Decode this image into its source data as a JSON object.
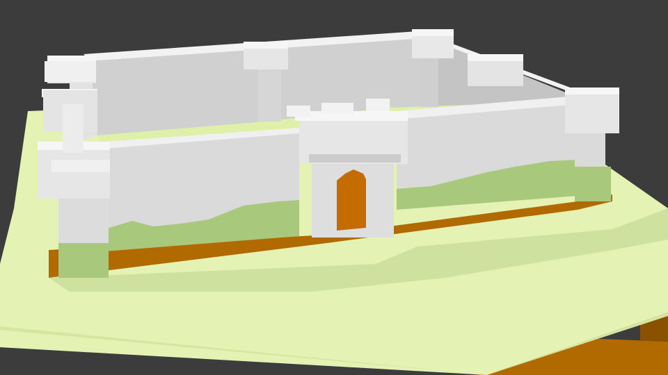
{
  "scene": {
    "subject": "voxel-castle",
    "colors": {
      "background": "#3c3c3c",
      "grass_top": "#e4f3b4",
      "grass_shade": "#ccdf9c",
      "dirt": "#b06a00",
      "dirt_dark": "#8a5200",
      "wall_front": "#dcdcdc",
      "wall_light": "#eeeeee",
      "wall_top": "#f4f4f4",
      "wall_shadow": "#bdbdbd",
      "wall_inner": "#cfcfcf",
      "bush": "#a8c87c",
      "bush_dark": "#8fb064",
      "door": "#c46c00"
    }
  }
}
